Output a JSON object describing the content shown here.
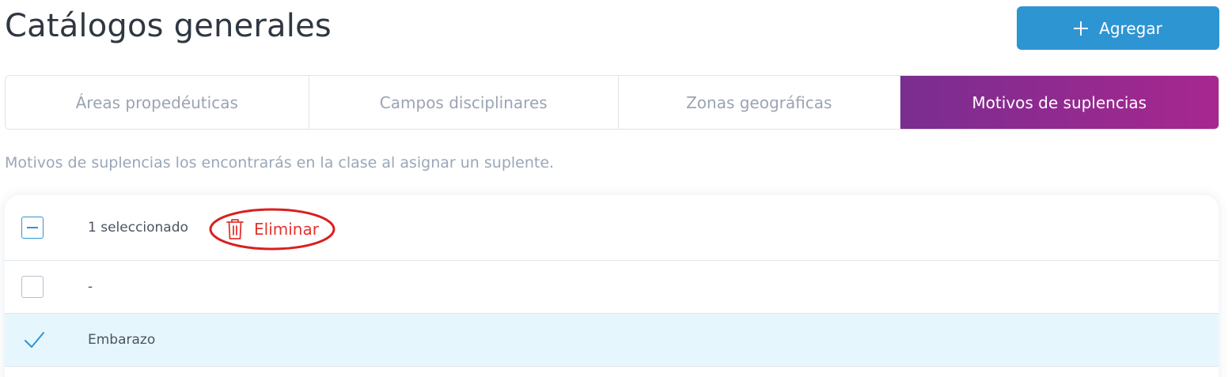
{
  "header": {
    "title": "Catálogos generales",
    "add_label": "Agregar"
  },
  "tabs": [
    {
      "label": "Áreas propedéuticas",
      "active": false
    },
    {
      "label": "Campos disciplinares",
      "active": false
    },
    {
      "label": "Zonas geográficas",
      "active": false
    },
    {
      "label": "Motivos de suplencias",
      "active": true
    }
  ],
  "description": "Motivos de suplencias los encontrarás en la clase al asignar un suplente.",
  "table": {
    "selection_text": "1 seleccionado",
    "delete_label": "Eliminar",
    "rows": [
      {
        "name": "-",
        "selected": false
      },
      {
        "name": "Embarazo",
        "selected": true
      }
    ]
  },
  "colors": {
    "primary": "#2e95d3",
    "tab_active_start": "#7a2d90",
    "tab_active_end": "#a7278f",
    "danger": "#e3342f",
    "selected_row": "#e6f6fd"
  },
  "icons": [
    "plus-icon",
    "trash-icon",
    "check-icon"
  ]
}
